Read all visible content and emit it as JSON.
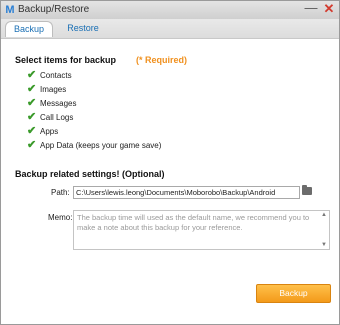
{
  "window": {
    "title": "Backup/Restore",
    "minimize_glyph": "—",
    "close_glyph": "✕",
    "app_icon": "M"
  },
  "tabs": [
    {
      "label": "Backup"
    },
    {
      "label": "Restore"
    }
  ],
  "items_section": {
    "heading": "Select items for backup",
    "required_note": "(* Required)",
    "items": [
      {
        "label": "Contacts",
        "checked": true
      },
      {
        "label": "Images",
        "checked": true
      },
      {
        "label": "Messages",
        "checked": true
      },
      {
        "label": "Call Logs",
        "checked": true
      },
      {
        "label": "Apps",
        "checked": true
      },
      {
        "label": "App Data (keeps your game save)",
        "checked": true
      }
    ]
  },
  "settings": {
    "heading": "Backup related settings! (Optional)",
    "path_label": "Path:",
    "path_value": "C:\\Users\\lewis.leong\\Documents\\Moborobo\\Backup\\Android",
    "memo_label": "Memo:",
    "memo_placeholder": "The backup time will used as the default name, we recommend you to make a note about this backup for your reference."
  },
  "actions": {
    "backup_label": "Backup"
  },
  "icons": {
    "check": "✔",
    "scroll_up": "▲",
    "scroll_down": "▼",
    "folder": "folder-icon"
  },
  "colors": {
    "accent": "#f39a1a",
    "required": "#f0901e",
    "check": "#3a9a2a",
    "tab_text": "#1a6fb4",
    "close": "#d23b2f"
  }
}
